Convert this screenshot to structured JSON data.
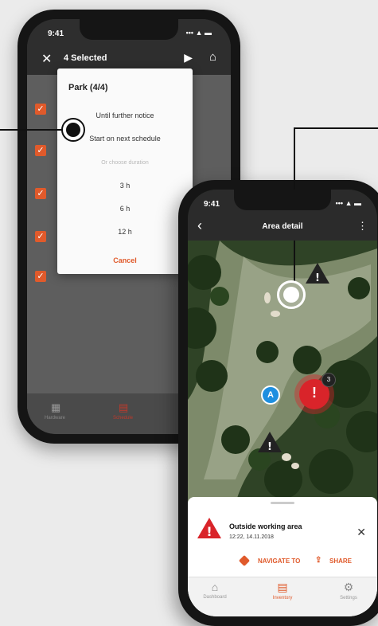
{
  "colors": {
    "accent": "#e05a2b",
    "alert": "#d9242a",
    "robot": "#1e8fe0"
  },
  "phone1": {
    "status_time": "9:41",
    "status_signal": "••• ▲ ▬",
    "header": {
      "title": "4 Selected",
      "close_icon": "✕",
      "play_icon": "▶",
      "home_icon": "⌂"
    },
    "dialog": {
      "title": "Park (4/4)",
      "options": [
        "Until further notice",
        "Start on next schedule"
      ],
      "divider_label": "Or choose duration",
      "durations": [
        "3 h",
        "6 h",
        "12 h"
      ],
      "cancel": "Cancel"
    },
    "bottom_tabs": [
      "Hardware",
      "Schedule"
    ]
  },
  "phone2": {
    "status_time": "9:41",
    "status_signal": "••• ▲ ▬",
    "header": {
      "title": "Area detail",
      "back_icon": "‹",
      "more_icon": "⋮"
    },
    "map": {
      "alert_count": "3",
      "robot_label": "A"
    },
    "sheet": {
      "title": "Outside working area",
      "timestamp": "12:22, 14.11.2018",
      "close_icon": "✕",
      "navigate_label": "NAVIGATE TO",
      "share_label": "SHARE"
    },
    "tabs": [
      {
        "label": "Dashboard",
        "icon": "⌂"
      },
      {
        "label": "Inventory",
        "icon": "▤"
      },
      {
        "label": "Settings",
        "icon": "⚙"
      }
    ]
  }
}
